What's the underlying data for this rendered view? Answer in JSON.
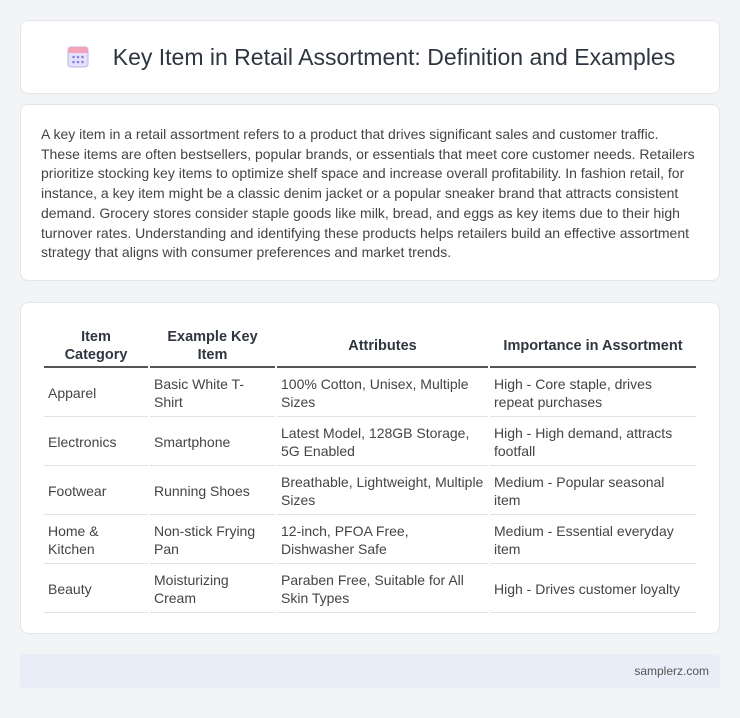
{
  "header": {
    "title": "Key Item in Retail Assortment: Definition and Examples",
    "icon": "document-calendar-icon"
  },
  "intro": {
    "text": "A key item in a retail assortment refers to a product that drives significant sales and customer traffic. These items are often bestsellers, popular brands, or essentials that meet core customer needs. Retailers prioritize stocking key items to optimize shelf space and increase overall profitability. In fashion retail, for instance, a key item might be a classic denim jacket or a popular sneaker brand that attracts consistent demand. Grocery stores consider staple goods like milk, bread, and eggs as key items due to their high turnover rates. Understanding and identifying these products helps retailers build an effective assortment strategy that aligns with consumer preferences and market trends."
  },
  "table": {
    "headers": [
      "Item Category",
      "Example Key Item",
      "Attributes",
      "Importance in Assortment"
    ],
    "rows": [
      [
        "Apparel",
        "Basic White T-Shirt",
        "100% Cotton, Unisex, Multiple Sizes",
        "High - Core staple, drives repeat purchases"
      ],
      [
        "Electronics",
        "Smartphone",
        "Latest Model, 128GB Storage, 5G Enabled",
        "High - High demand, attracts footfall"
      ],
      [
        "Footwear",
        "Running Shoes",
        "Breathable, Lightweight, Multiple Sizes",
        "Medium - Popular seasonal item"
      ],
      [
        "Home & Kitchen",
        "Non-stick Frying Pan",
        "12-inch, PFOA Free, Dishwasher Safe",
        "Medium - Essential everyday item"
      ],
      [
        "Beauty",
        "Moisturizing Cream",
        "Paraben Free, Suitable for All Skin Types",
        "High - Drives customer loyalty"
      ]
    ]
  },
  "footer": {
    "text": "samplerz.com"
  },
  "colors": {
    "icon_accent": "#8a7fe0",
    "icon_top": "#f08fae",
    "footer_bg": "#e8edf7"
  }
}
